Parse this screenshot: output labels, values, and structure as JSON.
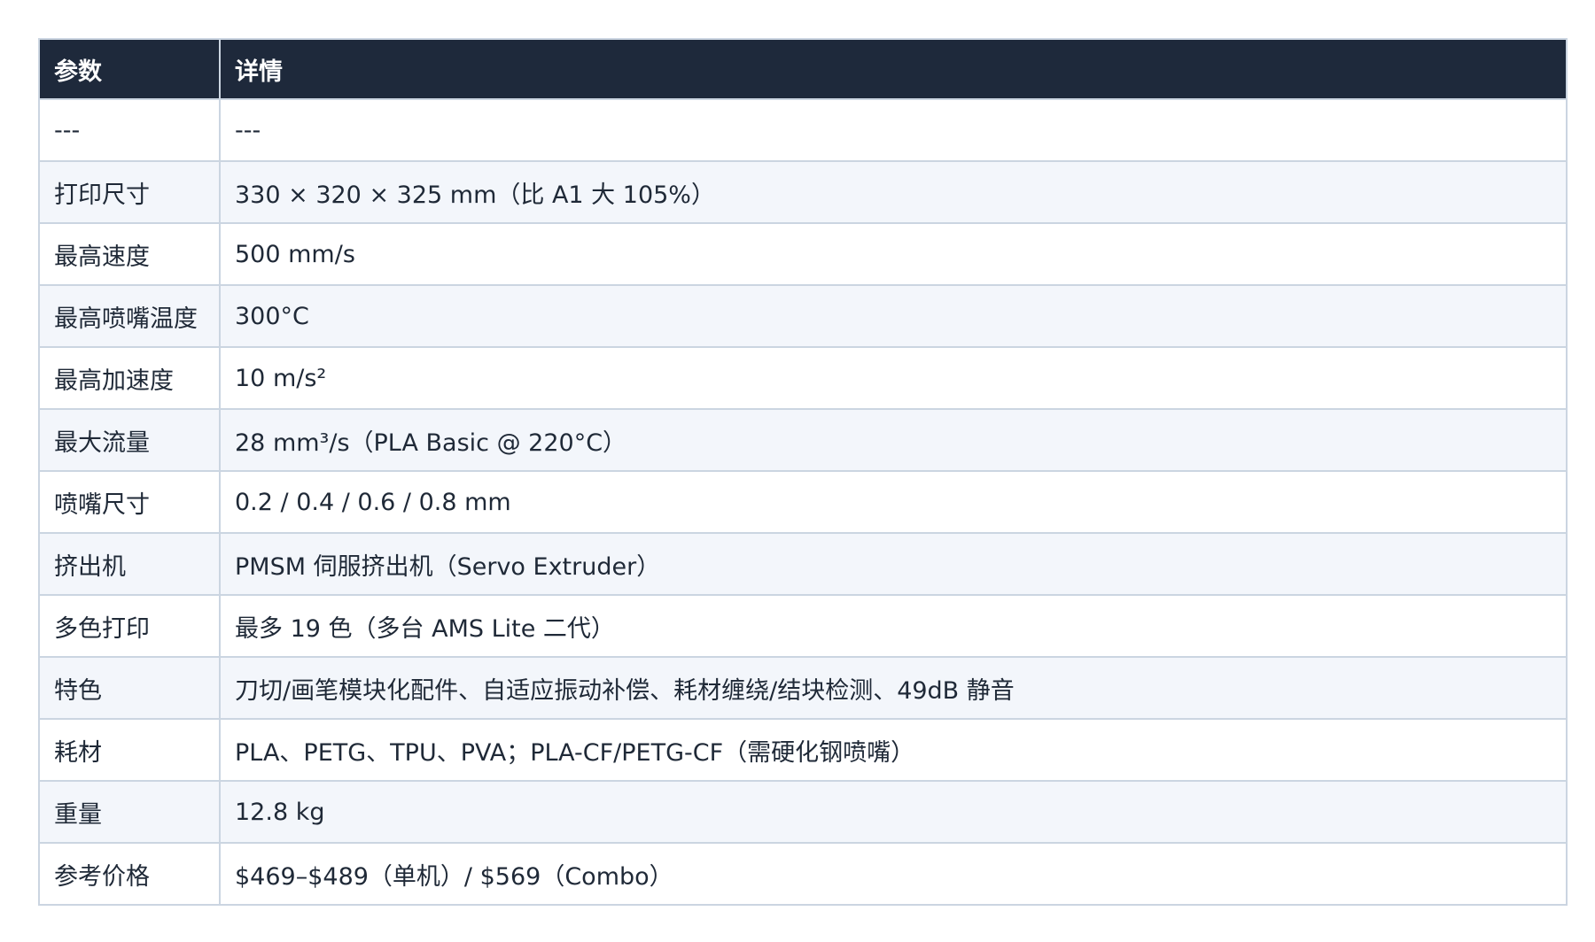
{
  "table": {
    "headers": [
      "参数",
      "详情"
    ],
    "rows": [
      [
        "---",
        "---"
      ],
      [
        "打印尺寸",
        "330 × 320 × 325 mm（比 A1 大 105%）"
      ],
      [
        "最高速度",
        "500 mm/s"
      ],
      [
        "最高喷嘴温度",
        "300°C"
      ],
      [
        "最高加速度",
        "10 m/s²"
      ],
      [
        "最大流量",
        "28 mm³/s（PLA Basic @ 220°C）"
      ],
      [
        "喷嘴尺寸",
        "0.2 / 0.4 / 0.6 / 0.8 mm"
      ],
      [
        "挤出机",
        "PMSM 伺服挤出机（Servo Extruder）"
      ],
      [
        "多色打印",
        "最多 19 色（多台 AMS Lite 二代）"
      ],
      [
        "特色",
        "刀切/画笔模块化配件、自适应振动补偿、耗材缠绕/结块检测、49dB 静音"
      ],
      [
        "耗材",
        "PLA、PETG、TPU、PVA；PLA-CF/PETG-CF（需硬化钢喷嘴）"
      ],
      [
        "重量",
        "12.8 kg"
      ],
      [
        "参考价格",
        "$469–$489（单机）/ $569（Combo）"
      ]
    ]
  }
}
